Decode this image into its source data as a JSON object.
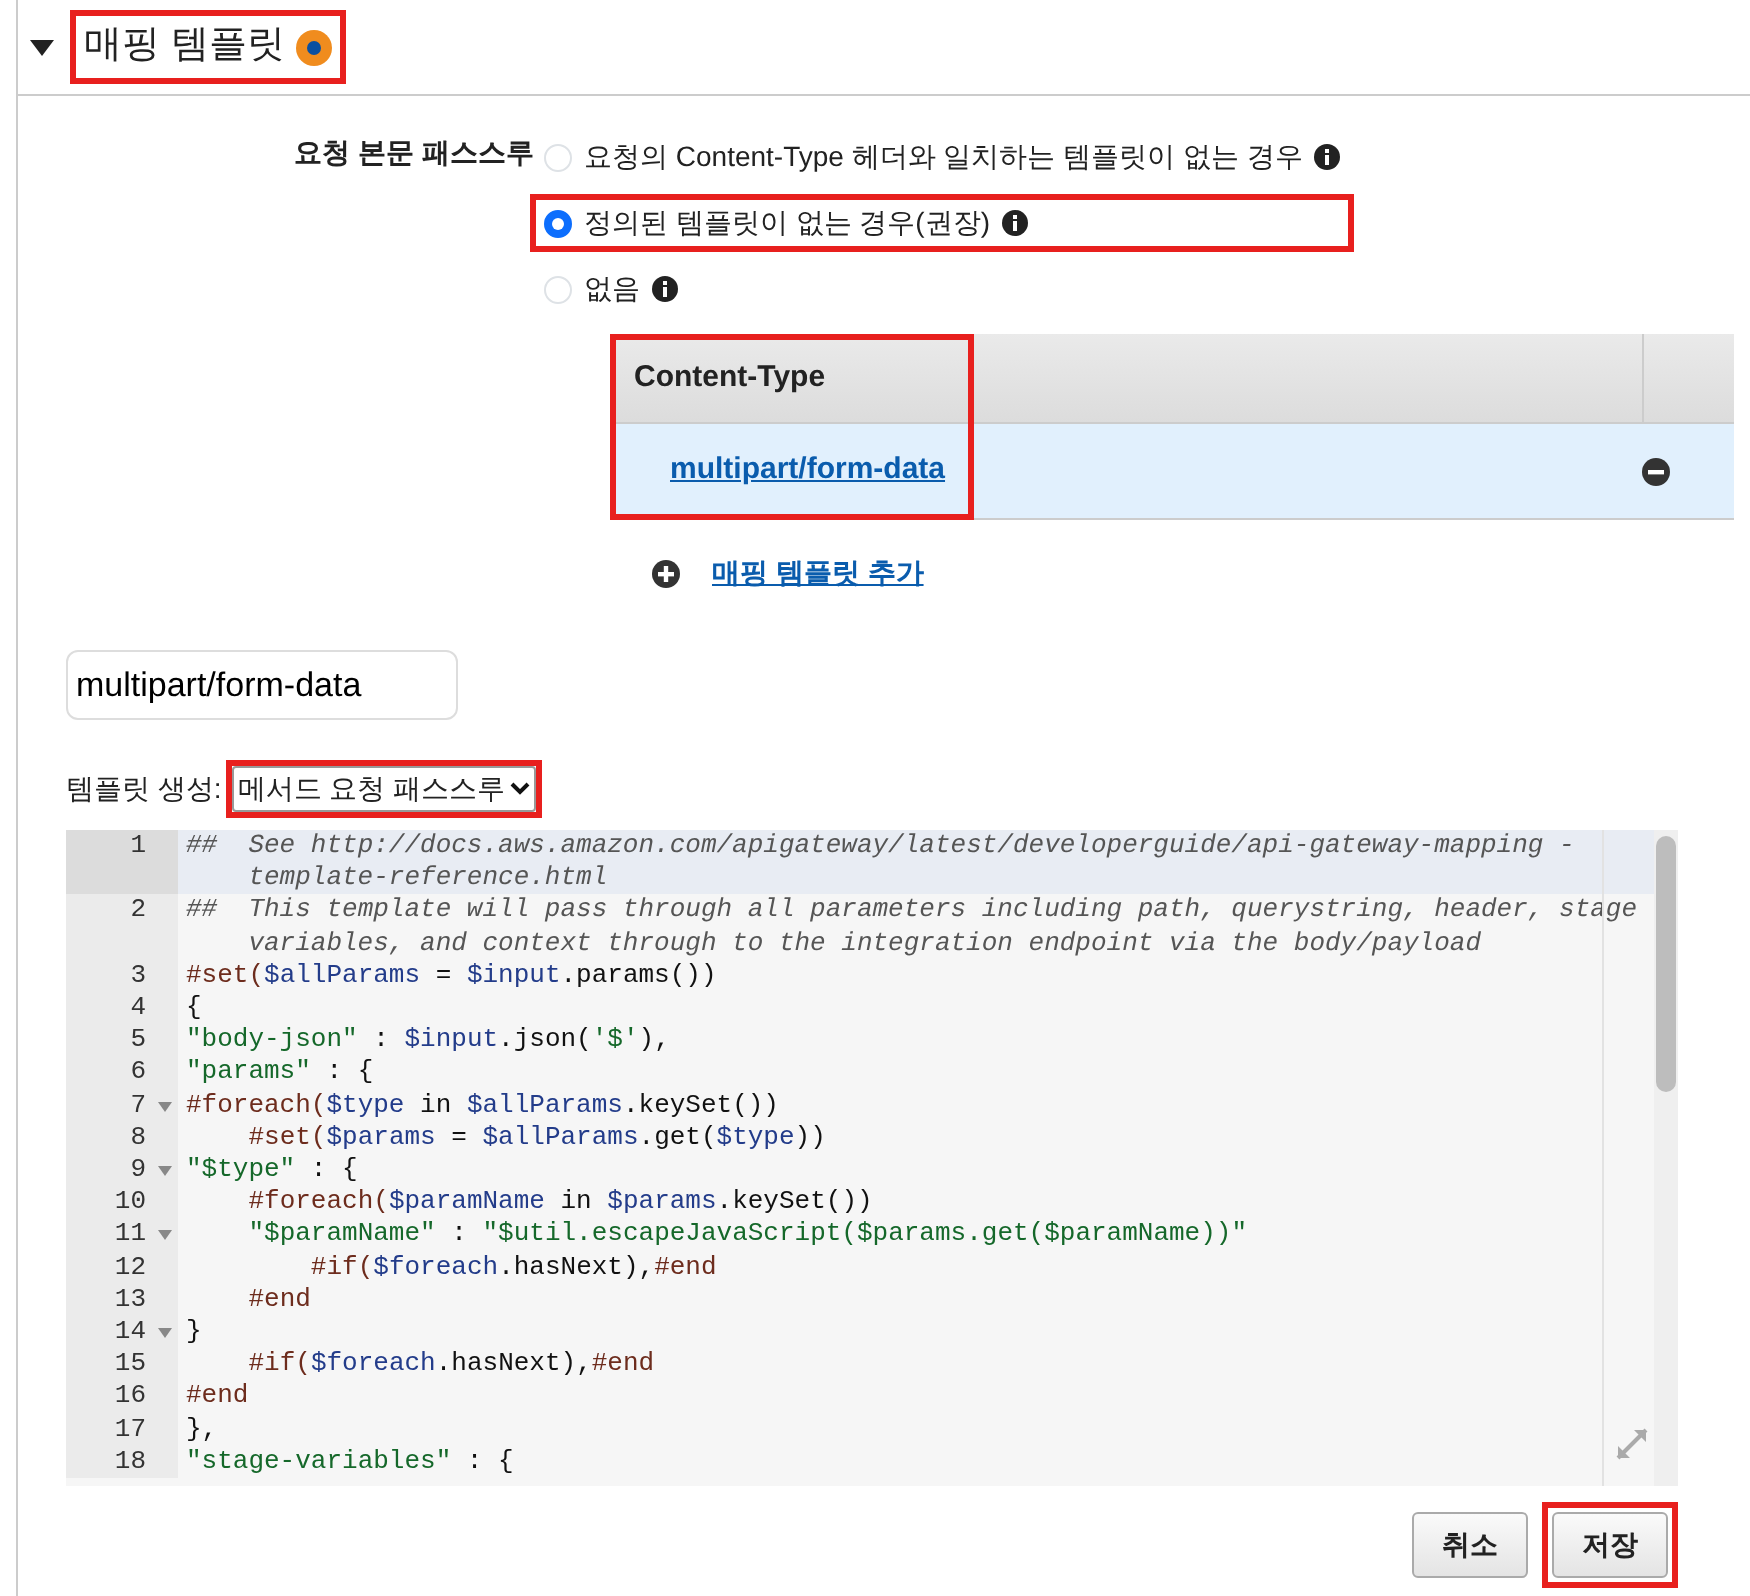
{
  "section": {
    "title": "매핑 템플릿",
    "expanded": true,
    "highlighted": true
  },
  "passthrough": {
    "label": "요청 본문 패스스루",
    "options": [
      {
        "label": "요청의 Content-Type 헤더와 일치하는 템플릿이 없는 경우",
        "selected": false,
        "highlighted": false
      },
      {
        "label": "정의된 템플릿이 없는 경우(권장)",
        "selected": true,
        "highlighted": true
      },
      {
        "label": "없음",
        "selected": false,
        "highlighted": false
      }
    ]
  },
  "content_types": {
    "column": "Content-Type",
    "highlighted": true,
    "rows": [
      {
        "value": "multipart/form-data",
        "selected": true
      }
    ]
  },
  "add_link": "매핑 템플릿 추가",
  "content_type_field": {
    "value": "multipart/form-data"
  },
  "generate": {
    "label": "템플릿 생성:",
    "value": "메서드 요청 패스스루",
    "highlighted": true
  },
  "editor": {
    "lines": [
      {
        "number": "1",
        "fold": false,
        "active": true,
        "tokens": [
          {
            "kind": "comment",
            "text": "##  See http://docs.aws.amazon.com/apigateway/latest/developerguide/api-gateway-mapping -template-reference.html"
          }
        ]
      },
      {
        "number": "2",
        "fold": false,
        "active": false,
        "tokens": [
          {
            "kind": "comment",
            "text": "##  This template will pass through all parameters including path, querystring, header, stage variables, and context through to the integration endpoint via the body/payload"
          }
        ]
      },
      {
        "number": "3",
        "fold": false,
        "active": false,
        "tokens": [
          {
            "kind": "directive",
            "text": "#set("
          },
          {
            "kind": "variable",
            "text": "$allParams"
          },
          {
            "kind": "plain",
            "text": " = "
          },
          {
            "kind": "variable",
            "text": "$input"
          },
          {
            "kind": "plain",
            "text": ".params())"
          }
        ]
      },
      {
        "number": "4",
        "fold": false,
        "active": false,
        "tokens": [
          {
            "kind": "plain",
            "text": "{"
          }
        ]
      },
      {
        "number": "5",
        "fold": false,
        "active": false,
        "tokens": [
          {
            "kind": "string",
            "text": "\"body-json\""
          },
          {
            "kind": "plain",
            "text": " : "
          },
          {
            "kind": "variable",
            "text": "$input"
          },
          {
            "kind": "plain",
            "text": ".json("
          },
          {
            "kind": "string",
            "text": "'$'"
          },
          {
            "kind": "plain",
            "text": "),"
          }
        ]
      },
      {
        "number": "6",
        "fold": false,
        "active": false,
        "tokens": [
          {
            "kind": "string",
            "text": "\"params\""
          },
          {
            "kind": "plain",
            "text": " : {"
          }
        ]
      },
      {
        "number": "7",
        "fold": true,
        "active": false,
        "tokens": [
          {
            "kind": "directive",
            "text": "#foreach("
          },
          {
            "kind": "variable",
            "text": "$type"
          },
          {
            "kind": "plain",
            "text": " in "
          },
          {
            "kind": "variable",
            "text": "$allParams"
          },
          {
            "kind": "plain",
            "text": ".keySet())"
          }
        ]
      },
      {
        "number": "8",
        "fold": false,
        "active": false,
        "tokens": [
          {
            "kind": "directive",
            "text": "    #set("
          },
          {
            "kind": "variable",
            "text": "$params"
          },
          {
            "kind": "plain",
            "text": " = "
          },
          {
            "kind": "variable",
            "text": "$allParams"
          },
          {
            "kind": "plain",
            "text": ".get("
          },
          {
            "kind": "variable",
            "text": "$type"
          },
          {
            "kind": "plain",
            "text": "))"
          }
        ]
      },
      {
        "number": "9",
        "fold": true,
        "active": false,
        "tokens": [
          {
            "kind": "string",
            "text": "\"$type\""
          },
          {
            "kind": "plain",
            "text": " : {"
          }
        ]
      },
      {
        "number": "10",
        "fold": false,
        "active": false,
        "tokens": [
          {
            "kind": "directive",
            "text": "    #foreach("
          },
          {
            "kind": "variable",
            "text": "$paramName"
          },
          {
            "kind": "plain",
            "text": " in "
          },
          {
            "kind": "variable",
            "text": "$params"
          },
          {
            "kind": "plain",
            "text": ".keySet())"
          }
        ]
      },
      {
        "number": "11",
        "fold": true,
        "active": false,
        "tokens": [
          {
            "kind": "string",
            "text": "    \"$paramName\""
          },
          {
            "kind": "plain",
            "text": " : "
          },
          {
            "kind": "string",
            "text": "\"$util.escapeJavaScript($params.get($paramName))\""
          }
        ]
      },
      {
        "number": "12",
        "fold": false,
        "active": false,
        "tokens": [
          {
            "kind": "directive",
            "text": "        #if("
          },
          {
            "kind": "variable",
            "text": "$foreach"
          },
          {
            "kind": "plain",
            "text": ".hasNext),"
          },
          {
            "kind": "directive",
            "text": "#end"
          }
        ]
      },
      {
        "number": "13",
        "fold": false,
        "active": false,
        "tokens": [
          {
            "kind": "directive",
            "text": "    #end"
          }
        ]
      },
      {
        "number": "14",
        "fold": true,
        "active": false,
        "tokens": [
          {
            "kind": "plain",
            "text": "}"
          }
        ]
      },
      {
        "number": "15",
        "fold": false,
        "active": false,
        "tokens": [
          {
            "kind": "directive",
            "text": "    #if("
          },
          {
            "kind": "variable",
            "text": "$foreach"
          },
          {
            "kind": "plain",
            "text": ".hasNext),"
          },
          {
            "kind": "directive",
            "text": "#end"
          }
        ]
      },
      {
        "number": "16",
        "fold": false,
        "active": false,
        "tokens": [
          {
            "kind": "directive",
            "text": "#end"
          }
        ]
      },
      {
        "number": "17",
        "fold": false,
        "active": false,
        "tokens": [
          {
            "kind": "plain",
            "text": "},"
          }
        ]
      },
      {
        "number": "18",
        "fold": false,
        "active": false,
        "tokens": [
          {
            "kind": "string",
            "text": "\"stage-variables\""
          },
          {
            "kind": "plain",
            "text": " : {"
          }
        ]
      }
    ]
  },
  "buttons": [
    {
      "label": "취소",
      "highlighted": false
    },
    {
      "label": "저장",
      "highlighted": true
    }
  ]
}
